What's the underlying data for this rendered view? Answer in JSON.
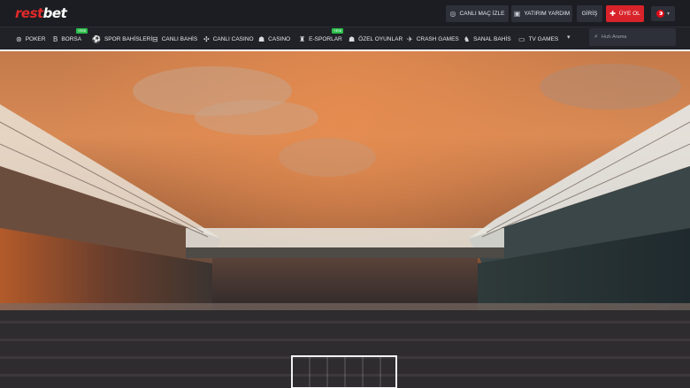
{
  "header": {
    "logo": {
      "part1": "rest",
      "part2": "bet"
    },
    "buttons": [
      {
        "label": "CANLI MAÇ İZLE",
        "icon": "tv-icon"
      },
      {
        "label": "YATIRIM YARDIM",
        "icon": "wallet-icon"
      },
      {
        "label": "GİRİŞ",
        "icon": ""
      },
      {
        "label": "ÜYE OL",
        "icon": "plus-icon"
      }
    ],
    "language": "tr-flag"
  },
  "nav": {
    "items": [
      {
        "label": "POKER",
        "icon": "chip-icon",
        "badge": ""
      },
      {
        "label": "BORSA",
        "icon": "bitcoin-icon",
        "badge": "YENİ"
      },
      {
        "label": "SPOR BAHİSLERİ",
        "icon": "ball-icon",
        "badge": ""
      },
      {
        "label": "CANLI BAHİS",
        "icon": "live-icon",
        "badge": ""
      },
      {
        "label": "CANLI CASINO",
        "icon": "cards-icon",
        "badge": ""
      },
      {
        "label": "CASINO",
        "icon": "casino-icon",
        "badge": ""
      },
      {
        "label": "E-SPORLAR",
        "icon": "esports-icon",
        "badge": "YENİ"
      },
      {
        "label": "ÖZEL OYUNLAR",
        "icon": "special-icon",
        "badge": ""
      },
      {
        "label": "CRASH GAMES",
        "icon": "rocket-icon",
        "badge": ""
      },
      {
        "label": "SANAL BAHİS",
        "icon": "virtual-icon",
        "badge": ""
      },
      {
        "label": "TV GAMES",
        "icon": "tv-icon",
        "badge": ""
      }
    ],
    "search_placeholder": "Hızlı Arama"
  },
  "colors": {
    "brand_red": "#d8232a",
    "new_badge": "#2bbf4a",
    "bar_bg": "#1b1d23"
  }
}
